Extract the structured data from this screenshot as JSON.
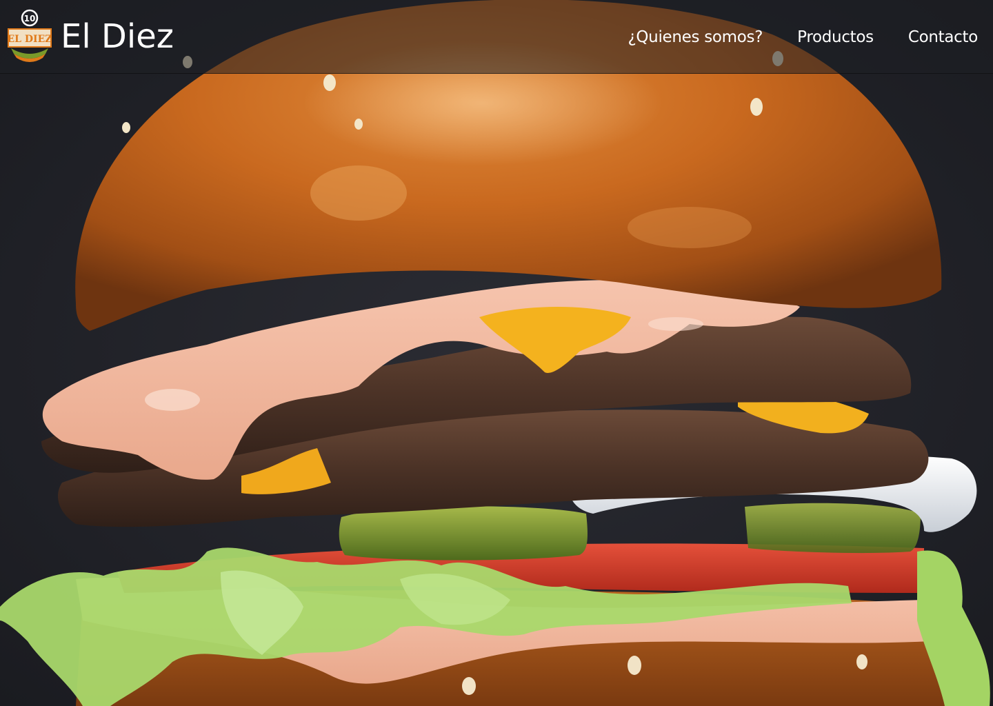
{
  "brand": {
    "name": "El Diez",
    "logo_text": "EL DIEZ",
    "logo_number": "10"
  },
  "nav": {
    "items": [
      {
        "label": "¿Quienes somos?"
      },
      {
        "label": "Productos"
      },
      {
        "label": "Contacto"
      }
    ]
  },
  "hero": {
    "image": "double-cheeseburger-photo"
  },
  "colors": {
    "background": "#24252b",
    "bun": "#c2651f",
    "sauce": "#f0b8a0",
    "cheese": "#f2a81c",
    "patty": "#4a3327",
    "lettuce": "#a8d86a",
    "tomato": "#d63a2a",
    "pickle": "#7a9a2a",
    "onion": "#e8ecf0",
    "logo_accent": "#e07a1a"
  }
}
